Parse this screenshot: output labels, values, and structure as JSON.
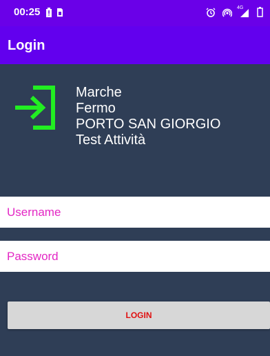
{
  "status_bar": {
    "time": "00:25",
    "left_icons": [
      "battery-alert-icon",
      "sim-icon"
    ],
    "right_icons": [
      "alarm-icon",
      "hotspot-icon",
      "signal-4g-icon",
      "battery-icon"
    ],
    "signal_label": "4G"
  },
  "app_bar": {
    "title": "Login"
  },
  "brand": {
    "icon": "login-arrow-icon",
    "icon_color": "#22ee22",
    "lines": [
      "Marche",
      "Fermo",
      "PORTO SAN GIORGIO",
      "Test Attività"
    ]
  },
  "form": {
    "username_placeholder": "Username",
    "password_placeholder": "Password",
    "login_label": "LOGIN"
  },
  "colors": {
    "primary": "#6200ee",
    "background": "#2f3e56",
    "placeholder": "#e326c4",
    "button_text": "#e01010"
  }
}
